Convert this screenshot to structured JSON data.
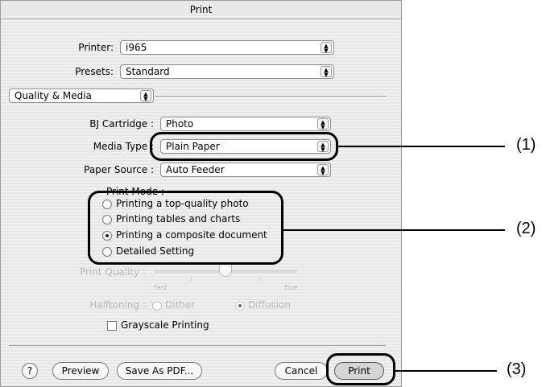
{
  "window": {
    "title": "Print"
  },
  "printer": {
    "label": "Printer:",
    "value": "i965"
  },
  "presets": {
    "label": "Presets:",
    "value": "Standard"
  },
  "panel": {
    "value": "Quality & Media"
  },
  "cartridge": {
    "label": "BJ Cartridge :",
    "value": "Photo"
  },
  "media": {
    "label": "Media Type :",
    "value": "Plain Paper"
  },
  "source": {
    "label": "Paper Source :",
    "value": "Auto Feeder"
  },
  "print_mode": {
    "label": "Print Mode :",
    "options": [
      {
        "label": "Printing a top-quality photo",
        "selected": false
      },
      {
        "label": "Printing tables and charts",
        "selected": false
      },
      {
        "label": "Printing a composite document",
        "selected": true
      },
      {
        "label": "Detailed Setting",
        "selected": false
      }
    ]
  },
  "quality": {
    "label": "Print Quality :",
    "fast": "Fast",
    "fine": "Fine"
  },
  "halftoning": {
    "label": "Halftoning :",
    "dither": "Dither",
    "diffusion": "Diffusion",
    "selected": "Diffusion"
  },
  "grayscale": {
    "label": "Grayscale Printing",
    "checked": false
  },
  "buttons": {
    "help": "?",
    "preview": "Preview",
    "save_pdf": "Save As PDF...",
    "cancel": "Cancel",
    "print": "Print"
  },
  "callouts": {
    "c1": "(1)",
    "c2": "(2)",
    "c3": "(3)"
  }
}
